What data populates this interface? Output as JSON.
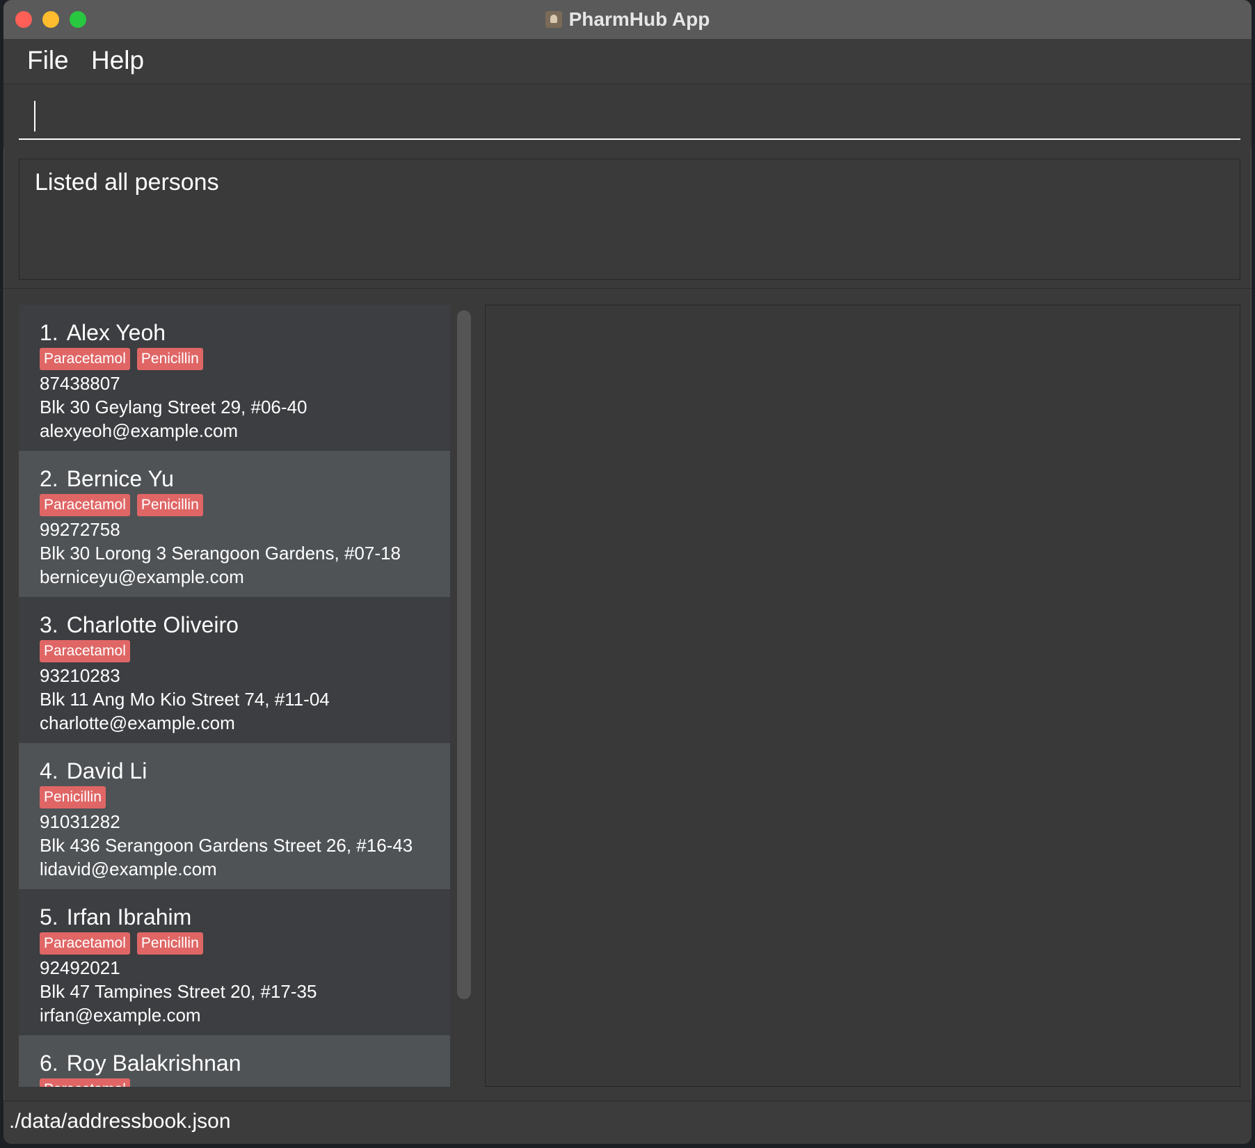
{
  "window": {
    "title": "PharmHub App"
  },
  "menu": {
    "file": "File",
    "help": "Help"
  },
  "command": {
    "value": "",
    "placeholder": ""
  },
  "result": {
    "message": "Listed all persons"
  },
  "persons": [
    {
      "index": "1.",
      "name": "Alex Yeoh",
      "tags": [
        "Paracetamol",
        "Penicillin"
      ],
      "phone": "87438807",
      "address": "Blk 30 Geylang Street 29, #06-40",
      "email": "alexyeoh@example.com"
    },
    {
      "index": "2.",
      "name": "Bernice Yu",
      "tags": [
        "Paracetamol",
        "Penicillin"
      ],
      "phone": "99272758",
      "address": "Blk 30 Lorong 3 Serangoon Gardens, #07-18",
      "email": "berniceyu@example.com"
    },
    {
      "index": "3.",
      "name": "Charlotte Oliveiro",
      "tags": [
        "Paracetamol"
      ],
      "phone": "93210283",
      "address": "Blk 11 Ang Mo Kio Street 74, #11-04",
      "email": "charlotte@example.com"
    },
    {
      "index": "4.",
      "name": "David Li",
      "tags": [
        "Penicillin"
      ],
      "phone": "91031282",
      "address": "Blk 436 Serangoon Gardens Street 26, #16-43",
      "email": "lidavid@example.com"
    },
    {
      "index": "5.",
      "name": "Irfan Ibrahim",
      "tags": [
        "Paracetamol",
        "Penicillin"
      ],
      "phone": "92492021",
      "address": "Blk 47 Tampines Street 20, #17-35",
      "email": "irfan@example.com"
    },
    {
      "index": "6.",
      "name": "Roy Balakrishnan",
      "tags": [
        "Paracetamol"
      ],
      "phone": "",
      "address": "",
      "email": ""
    }
  ],
  "status": {
    "path": "./data/addressbook.json"
  },
  "colors": {
    "tag": "#e06666",
    "card_odd": "#3c3e41",
    "card_even": "#4f5356"
  }
}
